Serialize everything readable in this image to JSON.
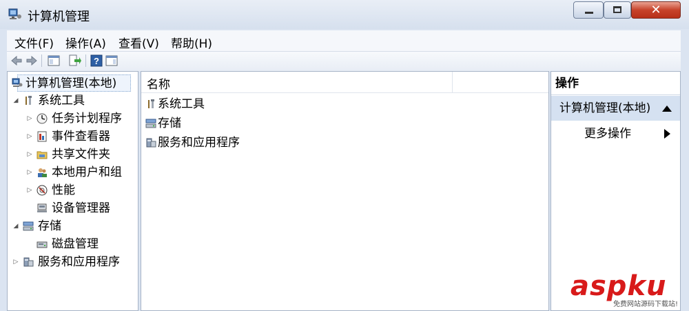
{
  "window": {
    "title": "计算机管理",
    "controls": {
      "minimize": "minimize-icon",
      "maximize": "maximize-icon",
      "close": "close-icon"
    }
  },
  "menubar": {
    "items": [
      {
        "label": "文件(F)"
      },
      {
        "label": "操作(A)"
      },
      {
        "label": "查看(V)"
      },
      {
        "label": "帮助(H)"
      }
    ]
  },
  "toolbar": {
    "icons": [
      "back-arrow-icon",
      "forward-arrow-icon",
      "show-hide-tree-icon",
      "export-list-icon",
      "help-icon",
      "show-hide-action-pane-icon"
    ]
  },
  "tree": {
    "root": {
      "label": "计算机管理(本地)",
      "icon": "computer-management-icon",
      "selected": true
    },
    "items": [
      {
        "label": "系统工具",
        "icon": "tools-icon",
        "expanded": true
      },
      {
        "label": "任务计划程序",
        "icon": "clock-icon",
        "expanded": false
      },
      {
        "label": "事件查看器",
        "icon": "event-viewer-icon",
        "expanded": false
      },
      {
        "label": "共享文件夹",
        "icon": "shared-folder-icon",
        "expanded": false
      },
      {
        "label": "本地用户和组",
        "icon": "users-icon",
        "expanded": false
      },
      {
        "label": "性能",
        "icon": "performance-icon",
        "expanded": false
      },
      {
        "label": "设备管理器",
        "icon": "device-manager-icon"
      },
      {
        "label": "存储",
        "icon": "storage-icon",
        "expanded": true
      },
      {
        "label": "磁盘管理",
        "icon": "disk-icon"
      },
      {
        "label": "服务和应用程序",
        "icon": "services-icon",
        "expanded": false
      }
    ]
  },
  "list": {
    "header": {
      "name": "名称"
    },
    "rows": [
      {
        "label": "系统工具",
        "icon": "tools-icon"
      },
      {
        "label": "存储",
        "icon": "storage-icon"
      },
      {
        "label": "服务和应用程序",
        "icon": "services-icon"
      }
    ]
  },
  "actions": {
    "title": "操作",
    "group": "计算机管理(本地)",
    "more": "更多操作"
  },
  "watermark": {
    "main": "aspku",
    "sub": "免费网站源码下载站!"
  }
}
